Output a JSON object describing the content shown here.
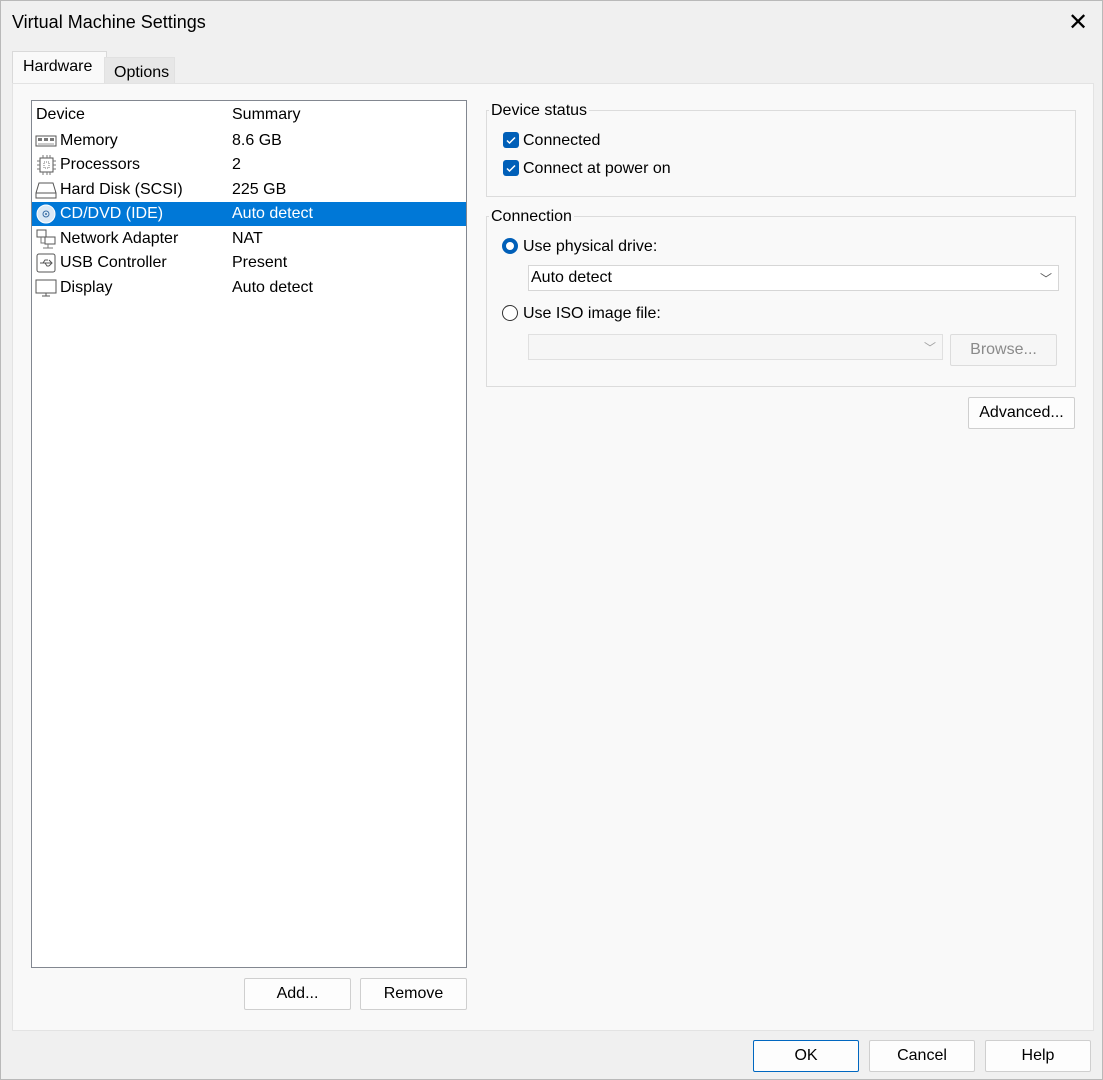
{
  "window": {
    "title": "Virtual Machine Settings"
  },
  "tabs": [
    {
      "label": "Hardware",
      "active": true
    },
    {
      "label": "Options",
      "active": false
    }
  ],
  "device_list": {
    "columns": [
      "Device",
      "Summary"
    ],
    "rows": [
      {
        "icon": "memory-icon",
        "name": "Memory",
        "summary": "8.6 GB",
        "selected": false
      },
      {
        "icon": "processor-icon",
        "name": "Processors",
        "summary": "2",
        "selected": false
      },
      {
        "icon": "hard-disk-icon",
        "name": "Hard Disk (SCSI)",
        "summary": "225 GB",
        "selected": false
      },
      {
        "icon": "cd-dvd-icon",
        "name": "CD/DVD (IDE)",
        "summary": "Auto detect",
        "selected": true
      },
      {
        "icon": "network-adapter-icon",
        "name": "Network Adapter",
        "summary": "NAT",
        "selected": false
      },
      {
        "icon": "usb-icon",
        "name": "USB Controller",
        "summary": "Present",
        "selected": false
      },
      {
        "icon": "display-icon",
        "name": "Display",
        "summary": "Auto detect",
        "selected": false
      }
    ],
    "add_label": "Add...",
    "remove_label": "Remove"
  },
  "device_status": {
    "title": "Device status",
    "connected_label": "Connected",
    "connected_checked": true,
    "power_on_label": "Connect at power on",
    "power_on_checked": true
  },
  "connection": {
    "title": "Connection",
    "physical_label": "Use physical drive:",
    "physical_selected": true,
    "physical_value": "Auto detect",
    "iso_label": "Use ISO image file:",
    "iso_selected": false,
    "iso_value": "",
    "browse_label": "Browse..."
  },
  "advanced_label": "Advanced...",
  "footer": {
    "ok": "OK",
    "cancel": "Cancel",
    "help": "Help"
  },
  "colors": {
    "accent": "#0078d7",
    "check": "#005fb8"
  }
}
